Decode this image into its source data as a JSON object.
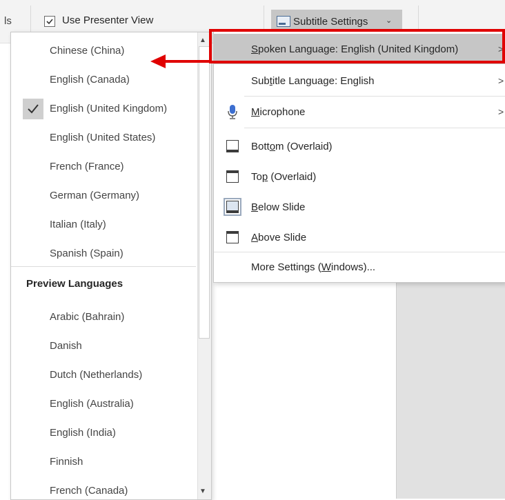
{
  "ribbon": {
    "cut_text": "ls",
    "presenter_view_label": "Use Presenter View",
    "presenter_view_checked": true,
    "subtitle_settings_label": "Subtitle Settings",
    "subtitle_settings_chevron": "chevron-down-icon"
  },
  "languages": {
    "items": [
      {
        "label": "Chinese (China)",
        "checked": false
      },
      {
        "label": "English (Canada)",
        "checked": false
      },
      {
        "label": "English (United Kingdom)",
        "checked": true
      },
      {
        "label": "English (United States)",
        "checked": false
      },
      {
        "label": "French (France)",
        "checked": false
      },
      {
        "label": "German (Germany)",
        "checked": false
      },
      {
        "label": "Italian (Italy)",
        "checked": false
      },
      {
        "label": "Spanish (Spain)",
        "checked": false
      }
    ],
    "preview_header": "Preview Languages",
    "preview_items": [
      {
        "label": "Arabic (Bahrain)"
      },
      {
        "label": "Danish"
      },
      {
        "label": "Dutch (Netherlands)"
      },
      {
        "label": "English (Australia)"
      },
      {
        "label": "English (India)"
      },
      {
        "label": "Finnish"
      },
      {
        "label": "French (Canada)"
      }
    ]
  },
  "submenu": {
    "spoken": {
      "pre": "",
      "key": "S",
      "post": "poken Language: English (United Kingdom)"
    },
    "subtitle": {
      "pre": "Sub",
      "key": "t",
      "post": "itle Language: English"
    },
    "microphone": {
      "pre": "",
      "key": "M",
      "post": "icrophone"
    },
    "bottom": {
      "pre": "Bott",
      "key": "o",
      "post": "m (Overlaid)"
    },
    "top": {
      "pre": "To",
      "key": "p",
      "post": " (Overlaid)"
    },
    "below": {
      "pre": "",
      "key": "B",
      "post": "elow Slide"
    },
    "above": {
      "pre": "",
      "key": "A",
      "post": "bove Slide"
    },
    "more": {
      "pre": "More Settings (",
      "key": "W",
      "post": "indows)..."
    },
    "submenu_arrow": ">"
  },
  "colors": {
    "highlight": "#c6c6c6",
    "annotation_red": "#e00000",
    "mic_blue": "#3d6fd0"
  }
}
